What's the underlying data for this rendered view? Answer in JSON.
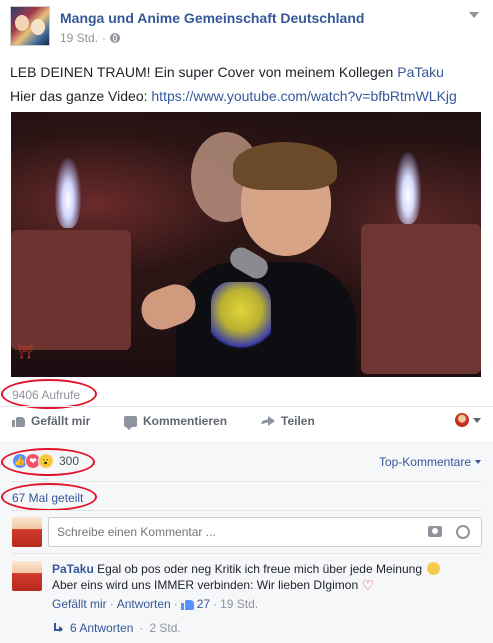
{
  "post": {
    "page_name": "Manga und Anime Gemeinschaft Deutschland",
    "time": "19 Std.",
    "dot": "·",
    "text_line1": "LEB DEINEN TRAUM! Ein super Cover von meinem Kollegen ",
    "mention": "PaTaku",
    "text_line2": "Hier das ganze Video: ",
    "link": "https://www.youtube.com/watch?v=bfbRtmWLKjg",
    "video_logo": "⛩"
  },
  "stats": {
    "views": "9406 Aufrufe",
    "reactions_count": "300",
    "shares": "67 Mal geteilt",
    "top_comments": "Top-Kommentare"
  },
  "actions": {
    "like": "Gefällt mir",
    "comment": "Kommentieren",
    "share": "Teilen"
  },
  "composer": {
    "placeholder": "Schreibe einen Kommentar ..."
  },
  "comment": {
    "author": "PaTaku",
    "text1": "Egal ob pos oder neg Kritik ich freue mich über jede Meinung",
    "text2": "Aber eins wird uns IMMER verbinden: Wir lieben DIgimon",
    "like": "Gefällt mir",
    "sep1": "·",
    "reply": "Antworten",
    "sep2": "·",
    "likes": "27",
    "sep3": "·",
    "time": "19 Std."
  },
  "replies": {
    "label": "6 Antworten",
    "sep": "·",
    "time": "2 Std."
  },
  "colors": {
    "link": "#365899",
    "highlight_ellipse": "#e0142a",
    "meta_gray": "#90949c"
  },
  "icons": [
    "globe-icon",
    "chevron-down-icon",
    "like-icon",
    "comment-icon",
    "share-icon",
    "camera-icon",
    "sticker-icon",
    "reply-arrow-icon",
    "smile-emoji-icon",
    "heart-emoji-icon"
  ]
}
